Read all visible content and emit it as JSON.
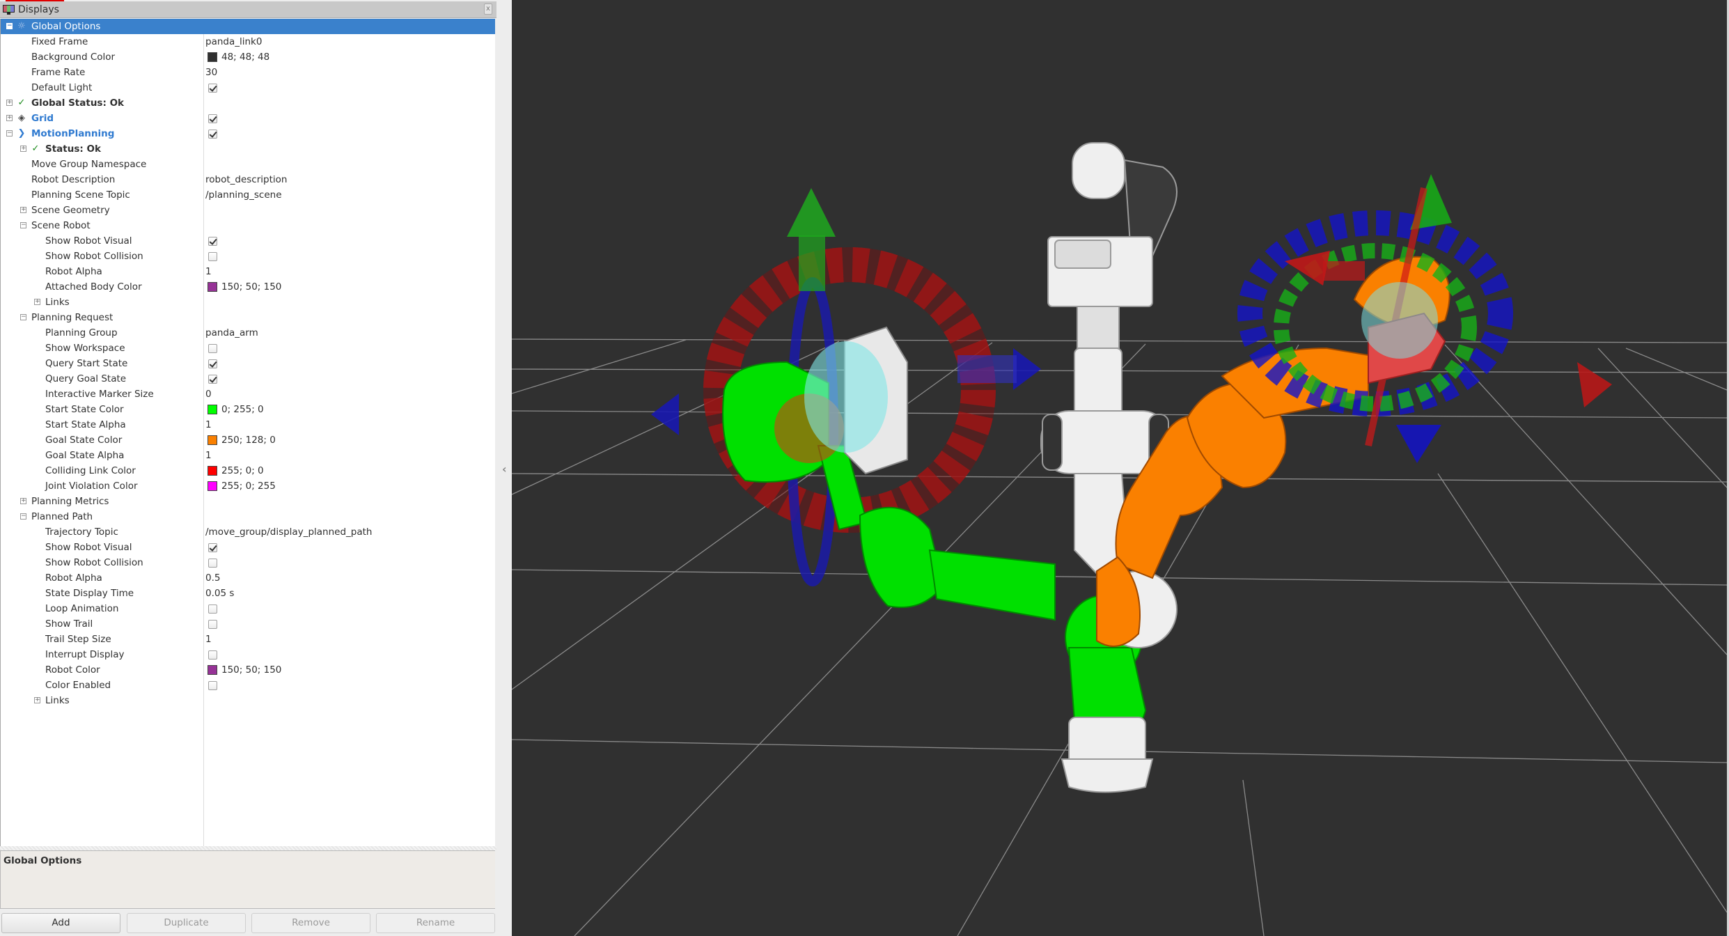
{
  "displays_panel": {
    "title": "Displays",
    "close_label": "x",
    "rows": [
      {
        "name": "Global Options",
        "level": 0,
        "expander": "minus",
        "icon": "gear-icon",
        "selected": true
      },
      {
        "name": "Fixed Frame",
        "level": 1,
        "value": "panda_link0"
      },
      {
        "name": "Background Color",
        "level": 1,
        "value": "48; 48; 48",
        "swatch": "#303030"
      },
      {
        "name": "Frame Rate",
        "level": 1,
        "value": "30"
      },
      {
        "name": "Default Light",
        "level": 1,
        "checkbox": true
      },
      {
        "name": "Global Status: Ok",
        "level": 0,
        "expander": "plus",
        "icon": "check-icon",
        "style": "bold"
      },
      {
        "name": "Grid",
        "level": 0,
        "expander": "plus",
        "icon": "grid-icon",
        "style": "blue",
        "checkbox": true
      },
      {
        "name": "MotionPlanning",
        "level": 0,
        "expander": "minus",
        "icon": "motion-planning-icon",
        "style": "blue",
        "checkbox": true
      },
      {
        "name": "Status: Ok",
        "level": 1,
        "expander": "plus",
        "icon": "check-icon",
        "style": "bold"
      },
      {
        "name": "Move Group Namespace",
        "level": 1,
        "value": ""
      },
      {
        "name": "Robot Description",
        "level": 1,
        "value": "robot_description"
      },
      {
        "name": "Planning Scene Topic",
        "level": 1,
        "value": "/planning_scene"
      },
      {
        "name": "Scene Geometry",
        "level": 1,
        "expander": "plus"
      },
      {
        "name": "Scene Robot",
        "level": 1,
        "expander": "minus"
      },
      {
        "name": "Show Robot Visual",
        "level": 2,
        "checkbox": true
      },
      {
        "name": "Show Robot Collision",
        "level": 2,
        "checkbox": false
      },
      {
        "name": "Robot Alpha",
        "level": 2,
        "value": "1"
      },
      {
        "name": "Attached Body Color",
        "level": 2,
        "value": "150; 50; 150",
        "swatch": "#963296"
      },
      {
        "name": "Links",
        "level": 2,
        "expander": "plus"
      },
      {
        "name": "Planning Request",
        "level": 1,
        "expander": "minus"
      },
      {
        "name": "Planning Group",
        "level": 2,
        "value": "panda_arm"
      },
      {
        "name": "Show Workspace",
        "level": 2,
        "checkbox": false
      },
      {
        "name": "Query Start State",
        "level": 2,
        "checkbox": true
      },
      {
        "name": "Query Goal State",
        "level": 2,
        "checkbox": true
      },
      {
        "name": "Interactive Marker Size",
        "level": 2,
        "value": "0"
      },
      {
        "name": "Start State Color",
        "level": 2,
        "value": "0; 255; 0",
        "swatch": "#00ff00"
      },
      {
        "name": "Start State Alpha",
        "level": 2,
        "value": "1"
      },
      {
        "name": "Goal State Color",
        "level": 2,
        "value": "250; 128; 0",
        "swatch": "#fa8000"
      },
      {
        "name": "Goal State Alpha",
        "level": 2,
        "value": "1"
      },
      {
        "name": "Colliding Link Color",
        "level": 2,
        "value": "255; 0; 0",
        "swatch": "#ff0000"
      },
      {
        "name": "Joint Violation Color",
        "level": 2,
        "value": "255; 0; 255",
        "swatch": "#ff00ff"
      },
      {
        "name": "Planning Metrics",
        "level": 1,
        "expander": "plus"
      },
      {
        "name": "Planned Path",
        "level": 1,
        "expander": "minus"
      },
      {
        "name": "Trajectory Topic",
        "level": 2,
        "value": "/move_group/display_planned_path"
      },
      {
        "name": "Show Robot Visual",
        "level": 2,
        "checkbox": true
      },
      {
        "name": "Show Robot Collision",
        "level": 2,
        "checkbox": false
      },
      {
        "name": "Robot Alpha",
        "level": 2,
        "value": "0.5"
      },
      {
        "name": "State Display Time",
        "level": 2,
        "value": "0.05 s"
      },
      {
        "name": "Loop Animation",
        "level": 2,
        "checkbox": false
      },
      {
        "name": "Show Trail",
        "level": 2,
        "checkbox": false
      },
      {
        "name": "Trail Step Size",
        "level": 2,
        "value": "1"
      },
      {
        "name": "Interrupt Display",
        "level": 2,
        "checkbox": false
      },
      {
        "name": "Robot Color",
        "level": 2,
        "value": "150; 50; 150",
        "swatch": "#963296"
      },
      {
        "name": "Color Enabled",
        "level": 2,
        "checkbox": false
      },
      {
        "name": "Links",
        "level": 2,
        "expander": "plus"
      }
    ],
    "description_title": "Global Options",
    "buttons": [
      {
        "label": "Add",
        "enabled": true
      },
      {
        "label": "Duplicate",
        "enabled": false
      },
      {
        "label": "Remove",
        "enabled": false
      },
      {
        "label": "Rename",
        "enabled": false
      }
    ]
  },
  "viewport": {
    "background_color": "#303030",
    "grid_color": "#a0a0a0",
    "robot_current_color": "#f0f0f0",
    "start_state_color": "#00ff00",
    "goal_state_color": "#fa8000",
    "marker_colors": {
      "x": "#cc1010",
      "y": "#10aa10",
      "z": "#1010cc"
    }
  }
}
